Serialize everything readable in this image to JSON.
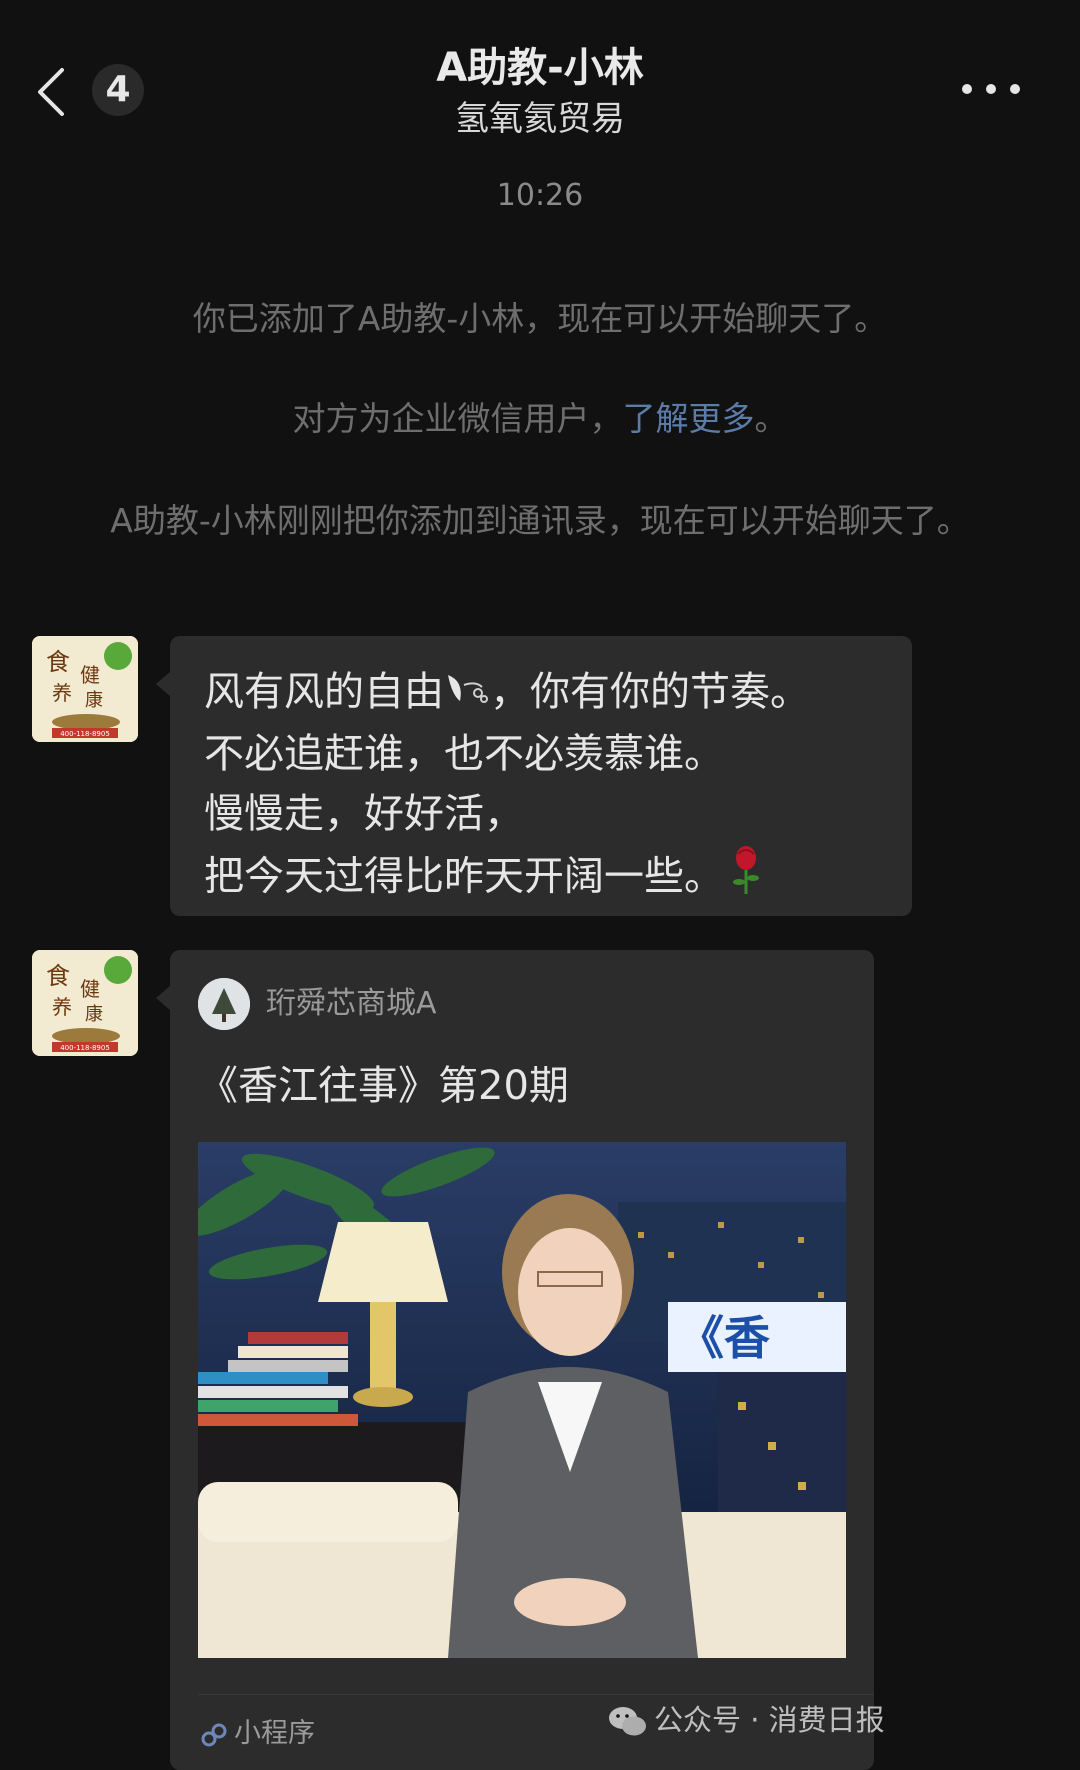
{
  "header": {
    "back_badge_count": "4",
    "title": "A助教-小林",
    "subtitle": "氢氧氦贸易"
  },
  "system": {
    "time": "10:26",
    "added_msg": "你已添加了A助教-小林，现在可以开始聊天了。",
    "enterprise_msg_prefix": "对方为企业微信用户，",
    "enterprise_msg_link": "了解更多",
    "enterprise_msg_suffix": "。",
    "contact_msg": "A助教-小林刚刚把你添加到通讯录，现在可以开始聊天了。"
  },
  "avatar": {
    "chars": [
      "食",
      "健",
      "养",
      "康"
    ],
    "phone": "400-118-8905"
  },
  "text_message": {
    "line1_a": "风有风的自由",
    "line1_b": "，你有你的节奏。",
    "line2": "不必追赶谁，也不必羡慕谁。",
    "line3": "慢慢走，好好活，",
    "line4": "把今天过得比昨天开阔一些。",
    "emoji_1": "wind-face-icon",
    "emoji_2": "rose-icon"
  },
  "card": {
    "source_name": "珩舜芯商城A",
    "title": "《香江往事》第20期",
    "image_text": "《香",
    "footer_label": "小程序"
  },
  "watermark": {
    "text": "公众号 · 消费日报"
  },
  "colors": {
    "background": "#111111",
    "bubble": "#2c2c2c",
    "link": "#5b7ca8"
  }
}
